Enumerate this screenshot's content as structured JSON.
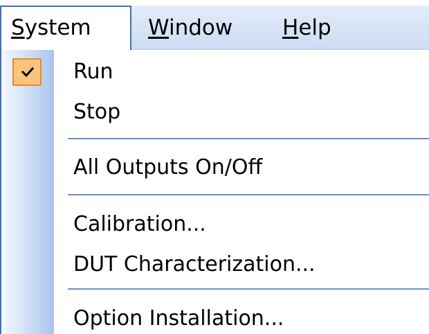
{
  "menubar": {
    "items": [
      {
        "label": "System",
        "mnemonic": "S",
        "rest": "ystem",
        "open": true
      },
      {
        "label": "Window",
        "mnemonic": "W",
        "rest": "indow",
        "open": false
      },
      {
        "label": "Help",
        "mnemonic": "H",
        "rest": "elp",
        "open": false
      }
    ]
  },
  "system_menu": {
    "items": [
      {
        "label": "Run",
        "checked": true
      },
      {
        "label": "Stop",
        "checked": false
      },
      {
        "label": "All Outputs On/Off",
        "checked": false
      },
      {
        "label": "Calibration...",
        "checked": false
      },
      {
        "label": "DUT Characterization...",
        "checked": false
      },
      {
        "label": "Option Installation...",
        "checked": false
      }
    ]
  },
  "colors": {
    "accent_border": "#3f6fb8",
    "check_background": "#fbc27b",
    "check_border": "#e8892f",
    "separator": "#6a8fd0"
  },
  "icons": {
    "checked_item": "checkmark-icon"
  }
}
